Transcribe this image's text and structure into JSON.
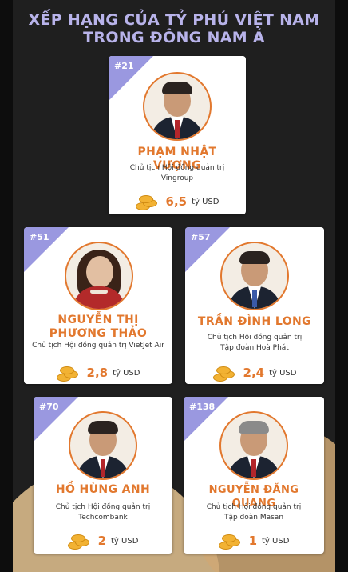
{
  "header": {
    "title_line1": "XẾP HẠNG CỦA TỶ PHÚ VIỆT NAM",
    "title_line2": "TRONG ĐÔNG NAM Á"
  },
  "billionaires": [
    {
      "rank": "#21",
      "name": "PHẠM NHẬT VƯỢNG",
      "name_line2": "",
      "role": "Chủ tịch Hội đồng quản trị\nVingroup",
      "amount": "6,5",
      "unit": "tỷ USD"
    },
    {
      "rank": "#51",
      "name": "NGUYỄN THỊ",
      "name_line2": "PHƯƠNG THẢO",
      "role": "Chủ tịch Hội đồng quản trị VietJet Air",
      "amount": "2,8",
      "unit": "tỷ USD"
    },
    {
      "rank": "#57",
      "name": "TRẦN ĐÌNH LONG",
      "name_line2": "",
      "role": "Chủ tịch Hội đồng quản trị\nTập đoàn Hoà Phát",
      "amount": "2,4",
      "unit": "tỷ USD"
    },
    {
      "rank": "#70",
      "name": "HỒ HÙNG ANH",
      "name_line2": "",
      "role": "Chủ tịch Hội đồng quản trị\nTechcombank",
      "amount": "2",
      "unit": "tỷ USD"
    },
    {
      "rank": "#138",
      "name": "NGUYỄN ĐĂNG QUANG",
      "name_line2": "",
      "role": "Chủ tịch Hội đồng quản trị\nTập đoàn Masan",
      "amount": "1",
      "unit": "tỷ USD"
    }
  ],
  "colors": {
    "accent": "#e2782e",
    "rank_badge": "#9a98e0",
    "title": "#b8b3ea",
    "background": "#1f1f1f"
  }
}
